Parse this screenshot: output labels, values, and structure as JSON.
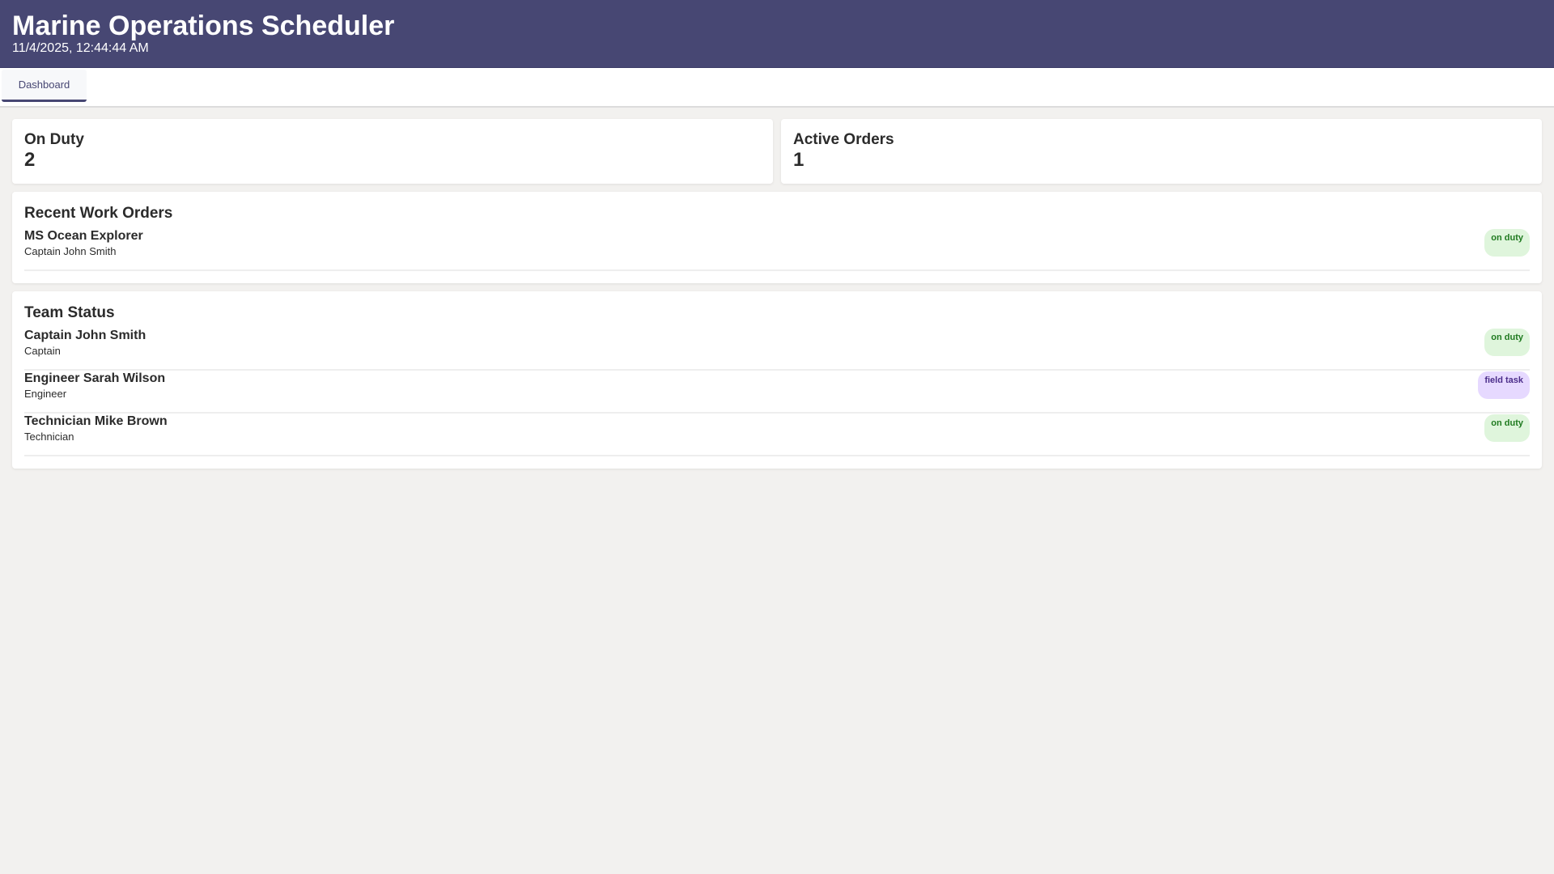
{
  "header": {
    "title": "Marine Operations Scheduler",
    "datetime": "11/4/2025, 12:44:44 AM"
  },
  "tabs": [
    {
      "label": "Dashboard",
      "active": true
    }
  ],
  "stats": [
    {
      "label": "On Duty",
      "value": "2"
    },
    {
      "label": "Active Orders",
      "value": "1"
    }
  ],
  "work_orders": {
    "title": "Recent Work Orders",
    "items": [
      {
        "name": "MS Ocean Explorer",
        "sub": "Captain John Smith",
        "status": "on duty"
      }
    ]
  },
  "team": {
    "title": "Team Status",
    "items": [
      {
        "name": "Captain John Smith",
        "sub": "Captain",
        "status": "on duty"
      },
      {
        "name": "Engineer Sarah Wilson",
        "sub": "Engineer",
        "status": "field task"
      },
      {
        "name": "Technician Mike Brown",
        "sub": "Technician",
        "status": "on duty"
      }
    ]
  },
  "colors": {
    "header": "#474773",
    "on_duty_bg": "#dff5dc",
    "field_task_bg": "#e6d9ff"
  }
}
